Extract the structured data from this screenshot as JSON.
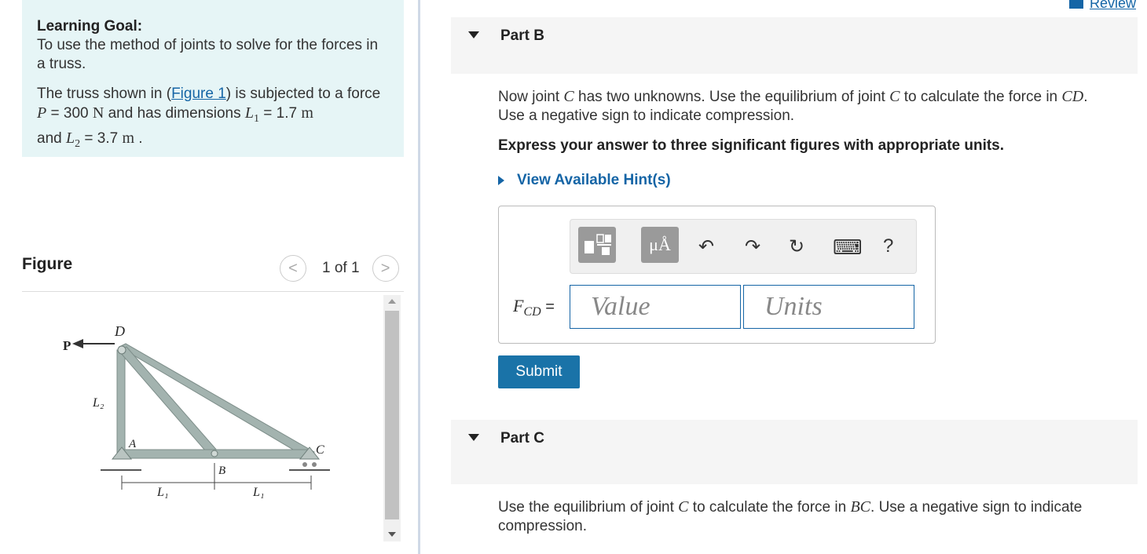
{
  "goal": {
    "title": "Learning Goal:",
    "text": "To use the method of joints to solve for the forces in a truss.",
    "para_prefix": "The truss shown in (",
    "figure_link": "Figure 1",
    "para_mid": ") is subjected to a force ",
    "P_sym": "P",
    "P_value": " = 300 ",
    "P_unit": "N",
    "para_dims": " and has dimensions ",
    "L1_sym": "L",
    "L1_sub": "1",
    "L1_value": " = 1.7 ",
    "L1_unit": "m",
    "and_text": "and ",
    "L2_sym": "L",
    "L2_sub": "2",
    "L2_value": " = 3.7 ",
    "L2_unit": "m",
    "end": " ."
  },
  "figure": {
    "label": "Figure",
    "pager": "1 of 1",
    "prev": "<",
    "next": ">",
    "labels": {
      "P": "P",
      "D": "D",
      "A": "A",
      "B": "B",
      "C": "C",
      "L2": "L₂",
      "L1a": "L₁",
      "L1b": "L₁"
    }
  },
  "review": "Review",
  "partB": {
    "title": "Part B",
    "q_1": "Now joint ",
    "q_C1": "C",
    "q_2": " has two unknowns. Use the equilibrium of joint ",
    "q_C2": "C",
    "q_3": " to calculate the force in ",
    "q_CD": "CD",
    "q_4": ".",
    "q_line2": "Use a negative sign to indicate compression.",
    "instruction": "Express your answer to three significant figures with appropriate units.",
    "hint": "View Available Hint(s)",
    "toolbar": {
      "units_btn": "μÅ",
      "undo": "↶",
      "redo": "↷",
      "reset": "↻",
      "keyboard": "⌨",
      "help": "?"
    },
    "label_F": "F",
    "label_sub": "CD",
    "label_eq": " =",
    "value_placeholder": "Value",
    "units_placeholder": "Units",
    "submit": "Submit"
  },
  "partC": {
    "title": "Part C",
    "q_1": "Use the equilibrium of joint ",
    "q_C": "C",
    "q_2": " to calculate the force in ",
    "q_BC": "BC",
    "q_3": ". Use a negative sign to indicate",
    "q_line2": "compression."
  },
  "colors": {
    "accent": "#1565a6",
    "goal_bg": "#e6f5f6",
    "submit_bg": "#1a73a8",
    "truss": "#98a8a4"
  }
}
